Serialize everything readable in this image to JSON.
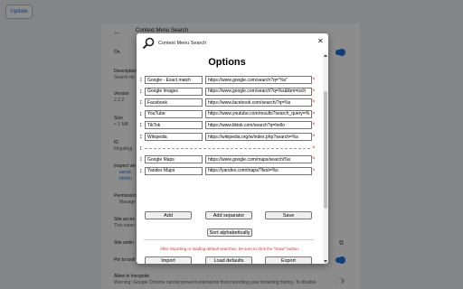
{
  "background": {
    "update_button": "Update",
    "page_title": "Context Menu Search",
    "on_label": "On",
    "description_label": "Description",
    "description_text": "Search for",
    "version_label": "Version",
    "version_value": "2.2.2",
    "size_label": "Size",
    "size_value": "< 1 MB",
    "id_label": "ID",
    "id_value": "ldngalbgj",
    "inspect_label": "Inspect vie",
    "inspect_link1": "servic",
    "inspect_link2": "html/o",
    "permissions_label": "Permission",
    "permissions_item": "Manage",
    "site_access_label": "Site acces",
    "site_access_text": "This exten",
    "site_settings_label": "Site settin",
    "pin_label": "Pin to tooll",
    "incognito_label": "Allow in Incognito",
    "incognito_text": "Warning: Google Chrome cannot prevent extensions from recording your browsing history. To disable"
  },
  "dialog": {
    "title": "Context Menu Search",
    "close_glyph": "✕",
    "options_heading": "Options",
    "drag_glyph": "↕",
    "delete_glyph": "×",
    "engines": [
      {
        "name": "Google - Exact match",
        "url": "https://www.google.com/search?q=\"%s\""
      },
      {
        "name": "Google Images",
        "url": "https://www.google.com/search?q=%s&tbm=isch"
      },
      {
        "name": "Facebook",
        "url": "https://www.facebook.com/search/?q=%s"
      },
      {
        "name": "YouTube",
        "url": "https://www.youtube.com/results?search_query=%s"
      },
      {
        "name": "TikTok",
        "url": "https://www.tiktok.com/search?q=hello"
      },
      {
        "name": "Wikipedia",
        "url": "https://wikipedia.org/w/index.php?search=%s"
      },
      {
        "separator": true
      },
      {
        "name": "Google Maps",
        "url": "https://www.google.com/maps/search/%s"
      },
      {
        "name": "Yandex Maps",
        "url": "https://yandex.com/maps/?text=%s"
      }
    ],
    "add_button": "Add",
    "add_separator_button": "Add separator",
    "save_button": "Save",
    "sort_button": "Sort alphabetically",
    "warning": "After importing or loading default searches, be sure to click the \"Save\" button.",
    "import_button": "Import",
    "load_defaults_button": "Load defaults",
    "export_button": "Export",
    "defaults": [
      {
        "name": "Google - Exact match",
        "url": "https://www.google.com/search?q=\"%s\""
      },
      {
        "name": "Google Images",
        "url": "https://www.google.com/search?q=%s&tbm=isch"
      },
      {
        "name": "Facebook",
        "url": "https://www.facebook.com/search/?q=%s"
      }
    ]
  }
}
